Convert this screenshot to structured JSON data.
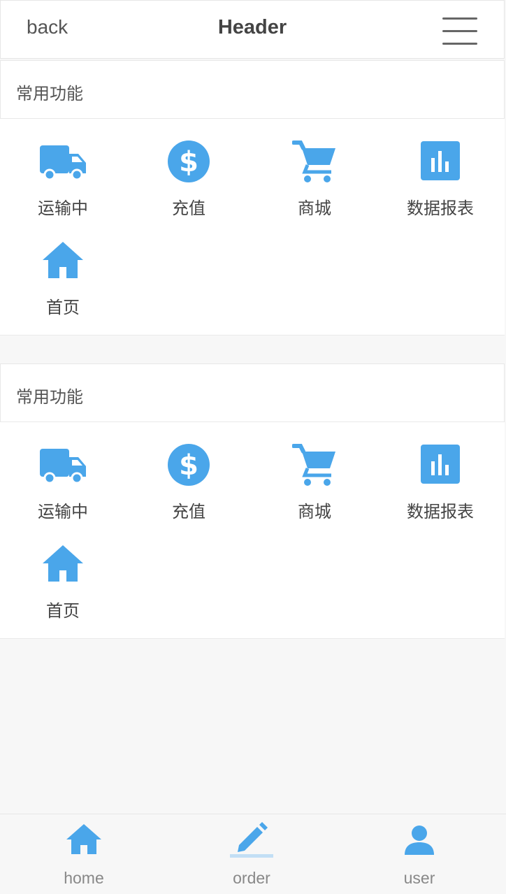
{
  "header": {
    "back_label": "back",
    "title": "Header",
    "menu_icon": "hamburger-icon"
  },
  "sections": [
    {
      "title": "常用功能",
      "items": [
        {
          "label": "运输中",
          "icon": "truck-icon"
        },
        {
          "label": "充值",
          "icon": "dollar-icon"
        },
        {
          "label": "商城",
          "icon": "cart-icon"
        },
        {
          "label": "数据报表",
          "icon": "bar-chart-icon"
        },
        {
          "label": "首页",
          "icon": "home-icon"
        }
      ]
    },
    {
      "title": "常用功能",
      "items": [
        {
          "label": "运输中",
          "icon": "truck-icon"
        },
        {
          "label": "充值",
          "icon": "dollar-icon"
        },
        {
          "label": "商城",
          "icon": "cart-icon"
        },
        {
          "label": "数据报表",
          "icon": "bar-chart-icon"
        },
        {
          "label": "首页",
          "icon": "home-icon"
        }
      ]
    }
  ],
  "tabbar": {
    "active": "order",
    "tabs": [
      {
        "label": "home",
        "icon": "home-icon"
      },
      {
        "label": "order",
        "icon": "pencil-icon"
      },
      {
        "label": "user",
        "icon": "user-icon"
      }
    ]
  },
  "colors": {
    "accent": "#4aa6ea",
    "active_indicator": "#c2dff5"
  }
}
